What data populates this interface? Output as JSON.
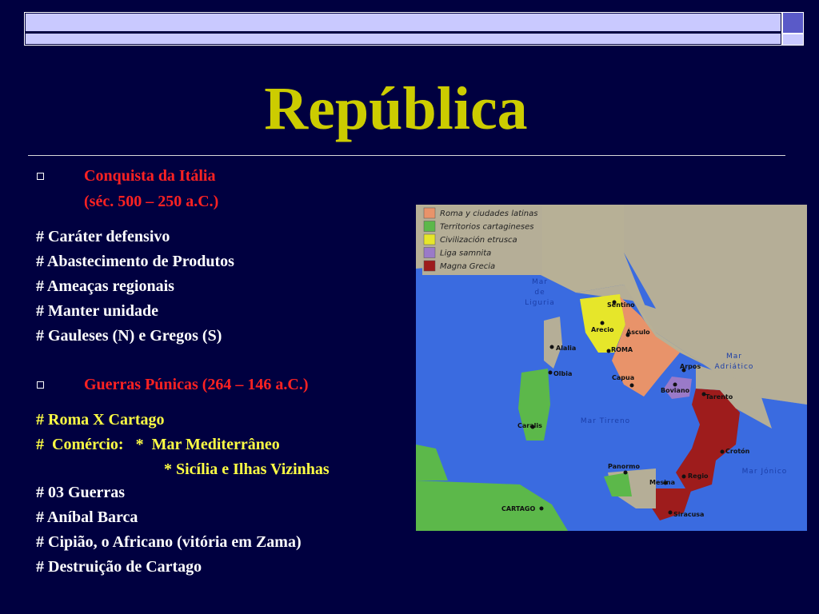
{
  "title": "República",
  "section1": {
    "heading_line1": "Conquista da Itália",
    "heading_line2": "(séc. 500 – 250 a.C.)",
    "items": [
      "# Caráter defensivo",
      "# Abastecimento de Produtos",
      "# Ameaças regionais",
      "# Manter unidade",
      "# Gauleses (N) e Gregos (S)"
    ]
  },
  "section2": {
    "heading": "Guerras Púnicas (264 – 146 a.C.)",
    "items_yellow": [
      "# Roma X Cartago",
      "#  Comércio:   *  Mar Mediterrâneo",
      "* Sicília e Ilhas Vizinhas"
    ],
    "items_white": [
      "# 03 Guerras",
      "# Aníbal Barca",
      "# Cipião, o Africano (vitória em Zama)",
      "# Destruição de Cartago"
    ]
  },
  "map": {
    "legend": [
      {
        "label": "Roma y ciudades latinas",
        "color": "#e8936a"
      },
      {
        "label": "Territorios cartagineses",
        "color": "#5cb84a"
      },
      {
        "label": "Civilización etrusca",
        "color": "#e6e62a"
      },
      {
        "label": "Liga samnita",
        "color": "#9a7ac8"
      },
      {
        "label": "Magna Grecia",
        "color": "#9e1c1c"
      }
    ],
    "seas": {
      "liguria": [
        "Mar",
        "de",
        "Liguria"
      ],
      "adriatico": [
        "Mar",
        "Adriático"
      ],
      "tirreno": "Mar Tirreno",
      "jonico": "Mar Jónico"
    },
    "cities": {
      "sentino": "Sentino",
      "arecio": "Arecio",
      "asculo": "Ásculo",
      "roma": "ROMA",
      "alalia": "Alalia",
      "olbia": "Olbia",
      "capua": "Capua",
      "arpos": "Arpos",
      "boviano": "Boviano",
      "tarento": "Tarento",
      "caralis": "Caralis",
      "croton": "Crotón",
      "panormo": "Panormo",
      "regio": "Regio",
      "mesina": "Mesina",
      "cartago": "CARTAGO",
      "siracusa": "Siracusa"
    }
  }
}
